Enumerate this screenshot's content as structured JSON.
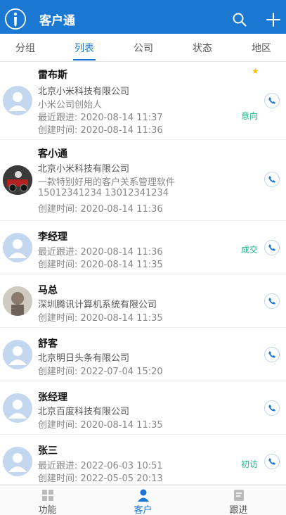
{
  "app": {
    "title": "客户通"
  },
  "tabs": [
    {
      "label": "分组"
    },
    {
      "label": "列表"
    },
    {
      "label": "公司"
    },
    {
      "label": "状态"
    },
    {
      "label": "地区"
    }
  ],
  "customers": [
    {
      "name": "雷布斯",
      "company": "北京小米科技有限公司",
      "note": "小米公司创始人",
      "last_follow": "最近跟进: 2020-08-14 11:37",
      "created": "创建时间: 2020-08-14 11:36",
      "stage": "意向",
      "starred": true
    },
    {
      "name": "客小通",
      "company": "北京小米科技有限公司",
      "note": "一款特别好用的客户关系管理软件",
      "phones": "15012341234 13012341234",
      "created": "创建时间: 2020-08-14 11:36"
    },
    {
      "name": "李经理",
      "last_follow": "最近跟进: 2020-08-14 11:36",
      "created": "创建时间: 2020-08-14 11:35",
      "stage": "成交"
    },
    {
      "name": "马总",
      "company": "深圳腾讯计算机系统有限公司",
      "created": "创建时间: 2020-08-14 11:35"
    },
    {
      "name": "舒客",
      "company": "北京明日头条有限公司",
      "created": "创建时间: 2022-07-04 15:20"
    },
    {
      "name": "张经理",
      "company": "北京百度科技有限公司",
      "created": "创建时间: 2020-08-14 11:35"
    },
    {
      "name": "张三",
      "last_follow": "最近跟进: 2022-06-03 10:51",
      "created": "创建时间: 2022-05-05 20:13",
      "stage": "初访"
    }
  ],
  "bottom_nav": [
    {
      "label": "功能"
    },
    {
      "label": "客户"
    },
    {
      "label": "跟进"
    }
  ],
  "colors": {
    "primary": "#1a77d2",
    "stage": "#1bb68d",
    "star": "#f5c400"
  }
}
